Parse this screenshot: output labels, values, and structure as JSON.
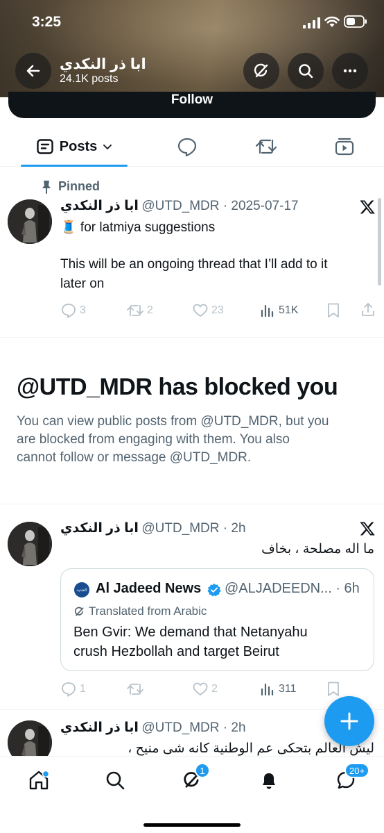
{
  "status_bar": {
    "time": "3:25"
  },
  "header": {
    "name": "ابا ذر النكدي",
    "post_count": "24.1K posts",
    "follow_label": "Follow"
  },
  "tabs": {
    "posts_label": "Posts"
  },
  "pinned_post": {
    "pinned_label": "Pinned",
    "author_name": "ابا ذر النكدي",
    "meta": "@UTD_MDR · 2025-07-17",
    "line1": "🧵 for latmiya suggestions",
    "line2": "This will be an ongoing thread that I’ll add to it",
    "line3": "later on",
    "stats": {
      "replies": "3",
      "reposts": "2",
      "likes": "23",
      "views": "51K"
    }
  },
  "blocked_notice": {
    "title": "@UTD_MDR has blocked you",
    "line1": "You can view public posts from @UTD_MDR, but you",
    "line2": "are blocked from engaging with them. You also",
    "line3": "cannot follow or message @UTD_MDR."
  },
  "post2": {
    "author_name": "ابا ذر النكدي",
    "meta": "@UTD_MDR · 2h",
    "text": "ما اله مصلحة ، بخاف",
    "quote": {
      "name": "Al Jadeed News",
      "handle": "@ALJADEEDN... · 6h",
      "translated_label": "Translated from Arabic",
      "line1": "Ben Gvir: We demand that Netanyahu",
      "line2": "crush Hezbollah and target Beirut",
      "logo_text": "الجديد"
    },
    "stats": {
      "replies": "1",
      "reposts": "",
      "likes": "2",
      "views": "311"
    }
  },
  "post3": {
    "author_name": "ابا ذر النكدي",
    "meta": "@UTD_MDR · 2h",
    "text": "ليش العالم بتحكى عم الوطنية كانه شى منيح ،"
  },
  "bottom_nav": {
    "grok_badge": "1",
    "messages_badge": "20+"
  },
  "colors": {
    "accent": "#1d9bf0",
    "text": "#0f1419",
    "secondary": "#536471"
  }
}
